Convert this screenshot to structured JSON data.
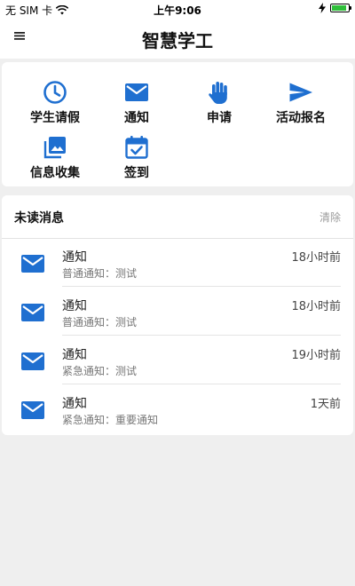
{
  "status_bar": {
    "carrier": "无 SIM 卡",
    "time": "上午9:06",
    "battery_percent": 90,
    "wifi_icon": "wifi-icon",
    "bolt_icon": "charging-bolt-icon"
  },
  "nav": {
    "title": "智慧学工",
    "menu_icon": "hamburger-menu-icon"
  },
  "colors": {
    "accent": "#1f6fd0",
    "background": "#efefef",
    "card": "#ffffff",
    "muted": "#9a9a9a"
  },
  "features": [
    {
      "label": "学生请假",
      "icon": "clock-icon"
    },
    {
      "label": "通知",
      "icon": "mail-icon"
    },
    {
      "label": "申请",
      "icon": "hand-icon"
    },
    {
      "label": "活动报名",
      "icon": "send-icon"
    },
    {
      "label": "信息收集",
      "icon": "photo-library-icon"
    },
    {
      "label": "签到",
      "icon": "calendar-check-icon"
    }
  ],
  "messages": {
    "header": "未读消息",
    "clear_label": "清除",
    "items": [
      {
        "title": "通知",
        "subtitle": "普通通知：测试",
        "time": "18小时前"
      },
      {
        "title": "通知",
        "subtitle": "普通通知：测试",
        "time": "18小时前"
      },
      {
        "title": "通知",
        "subtitle": "紧急通知：测试",
        "time": "19小时前"
      },
      {
        "title": "通知",
        "subtitle": "紧急通知：重要通知",
        "time": "1天前"
      }
    ]
  }
}
